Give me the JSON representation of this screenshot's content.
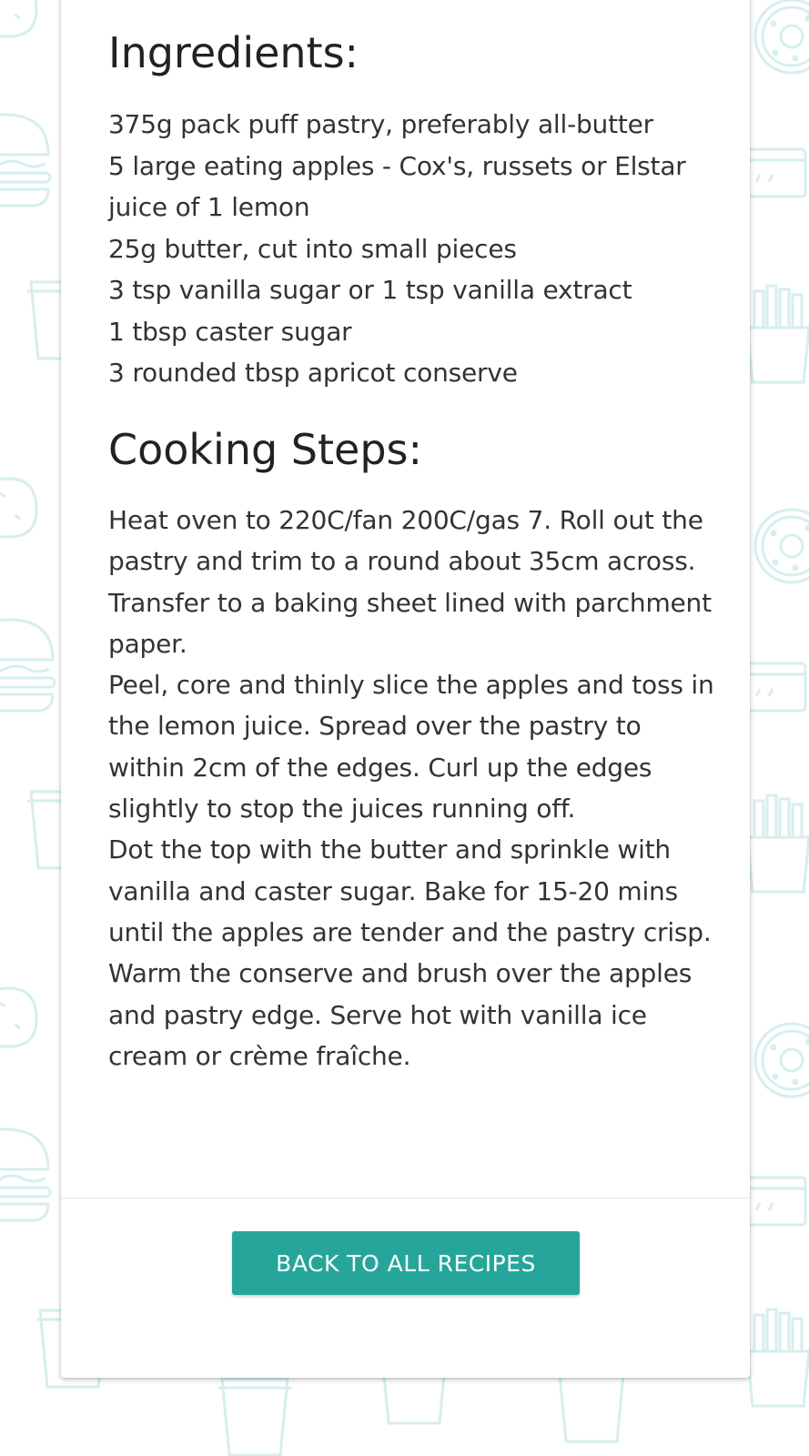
{
  "theme": {
    "accent": "#26a69a",
    "pattern_color": "#d7eeee"
  },
  "background": {
    "icons": [
      "donut-icon",
      "burger-icon",
      "taco-icon",
      "drink-cup-icon",
      "fries-icon",
      "container-icon"
    ]
  },
  "ingredients": {
    "title": "Ingredients:",
    "items": [
      "375g pack puff pastry, preferably all-butter",
      "5 large eating apples - Cox's, russets or Elstar",
      "juice of 1 lemon",
      "25g butter, cut into small pieces",
      "3 tsp vanilla sugar or 1 tsp vanilla extract",
      "1 tbsp caster sugar",
      "3 rounded tbsp apricot conserve"
    ]
  },
  "steps": {
    "title": "Cooking Steps:",
    "items": [
      "Heat oven to 220C/fan 200C/gas 7. Roll out the pastry and trim to a round about 35cm across. Transfer to a baking sheet lined with parchment paper.",
      "Peel, core and thinly slice the apples and toss in the lemon juice. Spread over the pastry to within 2cm of the edges. Curl up the edges slightly to stop the juices running off.",
      "Dot the top with the butter and sprinkle with vanilla and caster sugar. Bake for 15-20 mins until the apples are tender and the pastry crisp.",
      "Warm the conserve and brush over the apples and pastry edge. Serve hot with vanilla ice cream or crème fraîche."
    ]
  },
  "actions": {
    "back_label": "BACK TO ALL RECIPES"
  }
}
